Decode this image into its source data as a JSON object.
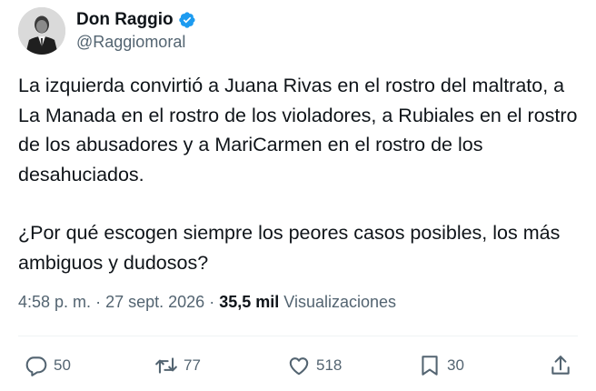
{
  "author": {
    "display_name": "Don Raggio",
    "handle": "@Raggiomoral",
    "verified_icon": "verified-badge-icon",
    "badge_color": "#1d9bf0"
  },
  "tweet": {
    "paragraphs": [
      "La izquierda convirtió a Juana Rivas en el rostro del maltrato, a La Manada en el rostro de los violadores, a Rubiales en el rostro de los abusadores y a MariCarmen en el rostro de los desahuciados.",
      "¿Por qué escogen siempre los peores casos posibles, los más ambiguos y dudosos?"
    ]
  },
  "meta": {
    "time": "4:58 p. m.",
    "separator": "·",
    "date": "27 sept. 2026",
    "views_count": "35,5 mil",
    "views_label": "Visualizaciones"
  },
  "actions": {
    "replies": {
      "icon": "reply-icon",
      "count": "50"
    },
    "retweets": {
      "icon": "retweet-icon",
      "count": "77"
    },
    "likes": {
      "icon": "heart-icon",
      "count": "518"
    },
    "bookmarks": {
      "icon": "bookmark-icon",
      "count": "30"
    },
    "share": {
      "icon": "share-icon"
    }
  },
  "colors": {
    "text_primary": "#0f1419",
    "text_secondary": "#536471",
    "accent": "#1d9bf0",
    "divider": "#eff3f4"
  }
}
